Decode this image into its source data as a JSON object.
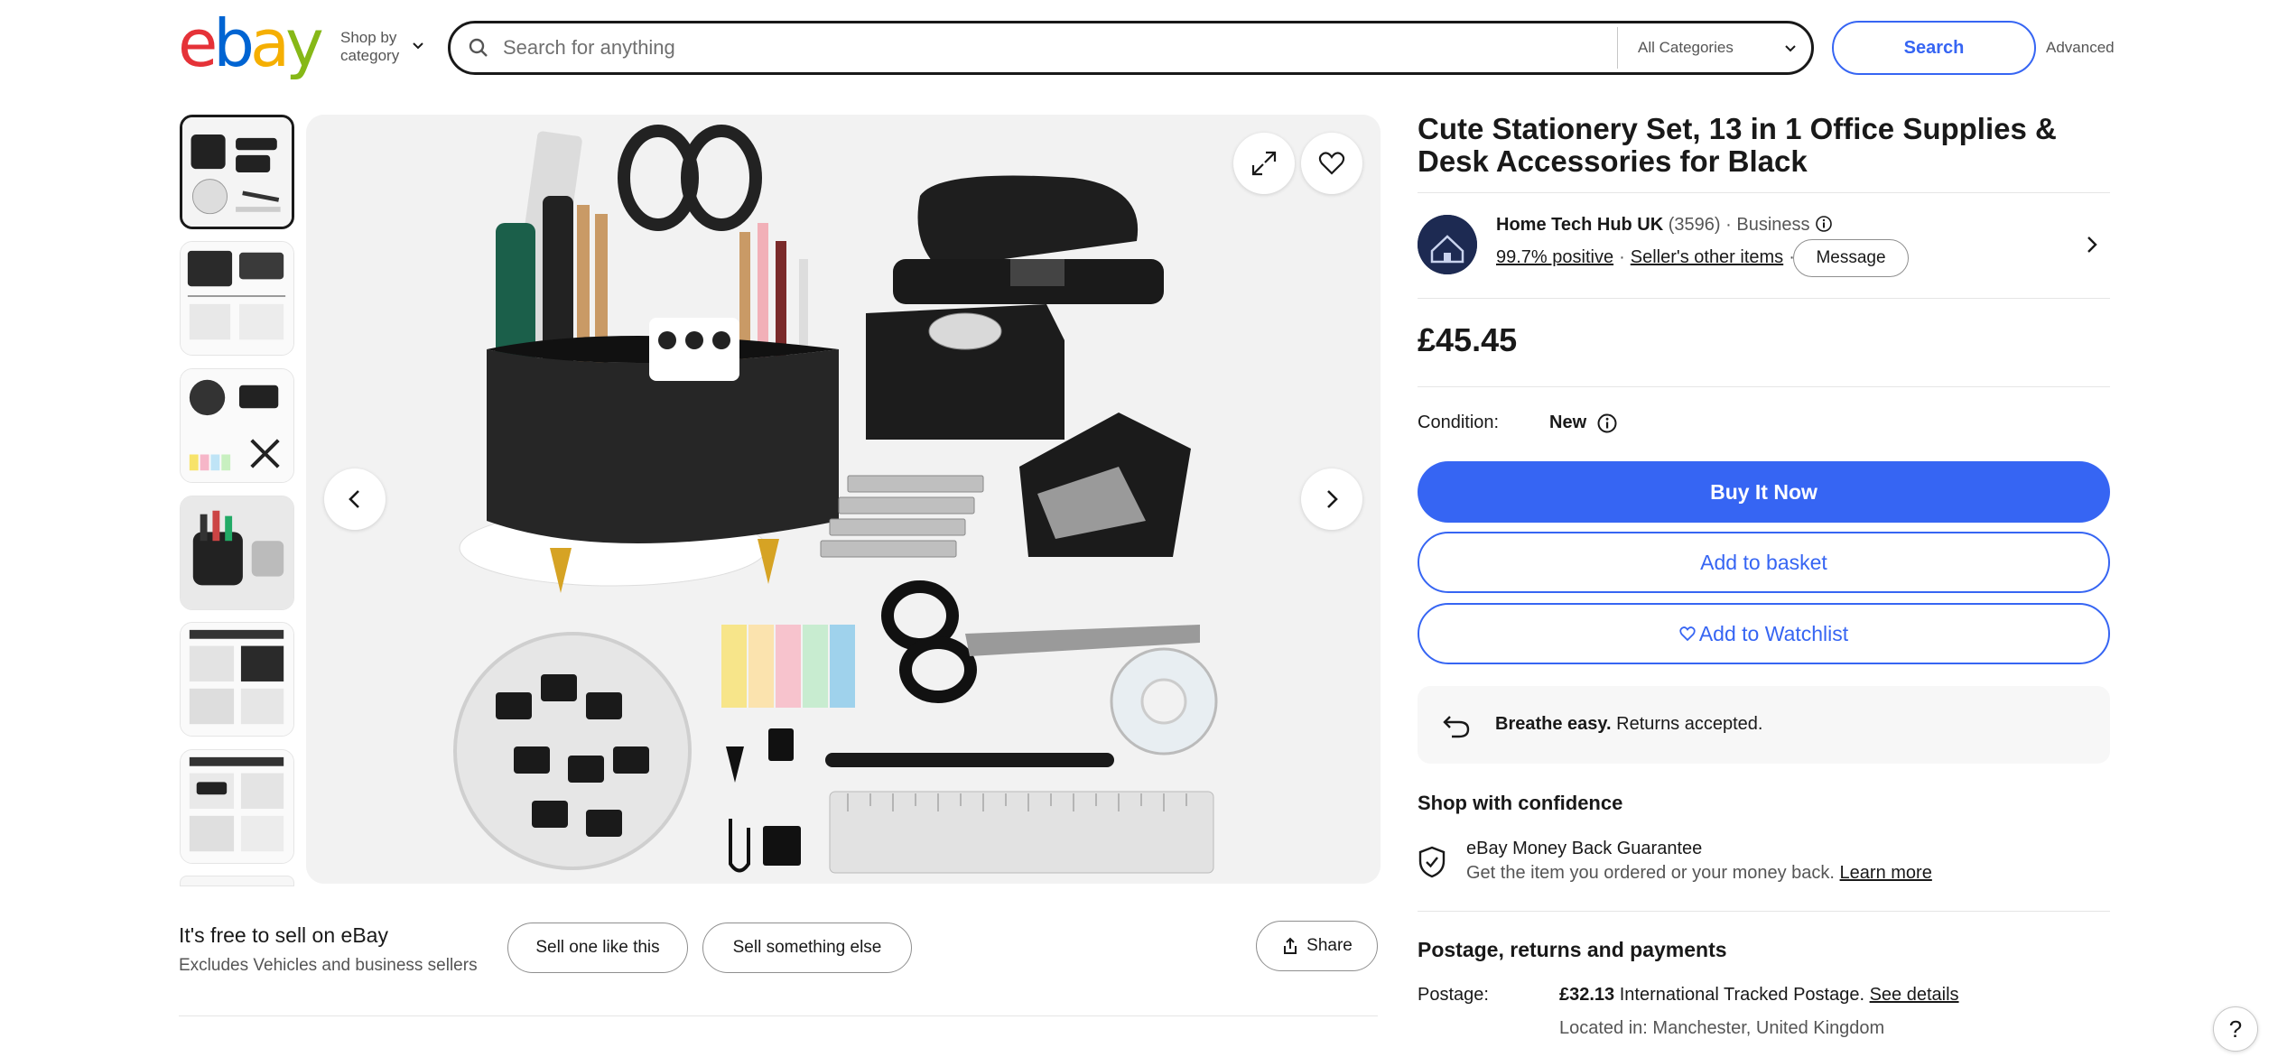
{
  "header": {
    "logo_letters": [
      "e",
      "b",
      "a",
      "y"
    ],
    "shop_by_category": "Shop by category",
    "search_placeholder": "Search for anything",
    "category_select": "All Categories",
    "search_button": "Search",
    "advanced_link": "Advanced"
  },
  "gallery": {
    "thumbnail_count": 6,
    "selected_thumbnail": 1,
    "icons": {
      "expand": "expand-icon",
      "watch": "heart-icon",
      "prev": "chevron-left-icon",
      "next": "chevron-right-icon"
    }
  },
  "sell": {
    "title": "It's free to sell on eBay",
    "subtitle": "Excludes Vehicles and business sellers",
    "sell_one_like_this": "Sell one like this",
    "sell_something_else": "Sell something else",
    "share": "Share"
  },
  "item": {
    "title": "Cute Stationery Set, 13 in 1 Office Supplies & Desk Accessories for Black",
    "price": "£45.45",
    "condition_label": "Condition:",
    "condition_value": "New"
  },
  "seller": {
    "name": "Home Tech Hub UK",
    "feedback_count": "(3596)",
    "separator": "·",
    "type": "Business",
    "positive": "99.7% positive",
    "other_items": "Seller's other items",
    "message_button": "Message"
  },
  "actions": {
    "buy_it_now": "Buy It Now",
    "add_to_basket": "Add to basket",
    "add_to_watchlist": "Add to Watchlist"
  },
  "returns": {
    "bold": "Breathe easy.",
    "text": "Returns accepted."
  },
  "confidence": {
    "heading": "Shop with confidence",
    "guarantee_title": "eBay Money Back Guarantee",
    "guarantee_text": "Get the item you ordered or your money back.",
    "learn_more": "Learn more"
  },
  "postage": {
    "heading": "Postage, returns and payments",
    "label": "Postage:",
    "amount": "£32.13",
    "method": "International Tracked Postage.",
    "see_details": "See details",
    "located": "Located in: Manchester, United Kingdom"
  },
  "help": "?",
  "colors": {
    "accent": "#3665f3",
    "logo_e": "#e53238",
    "logo_b": "#0064d2",
    "logo_a": "#f5af02",
    "logo_y": "#86b817"
  }
}
